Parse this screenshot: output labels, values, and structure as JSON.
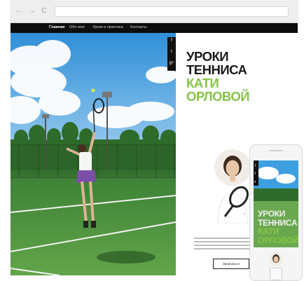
{
  "browser": {
    "nav_icons": [
      "back-icon",
      "forward-icon",
      "reload-icon"
    ],
    "nav_glyphs": "← → C"
  },
  "site": {
    "nav": {
      "items": [
        "Главная",
        "Обо мне",
        "Уроки и практика",
        "Контакты"
      ],
      "active_index": 0
    },
    "social": [
      {
        "icon": "facebook-icon",
        "glyph": "f"
      },
      {
        "icon": "twitter-icon",
        "glyph": "t"
      },
      {
        "icon": "googleplus-icon",
        "glyph": "g+"
      }
    ],
    "title": {
      "line1": "УРОКИ",
      "line2": "ТЕННИСА",
      "line3": "КАТИ",
      "line4": "ОРЛОВОЙ"
    },
    "cta_label": "Записаться"
  },
  "phone": {
    "title": {
      "line1": "УРОКИ",
      "line2": "ТЕННИСА",
      "line3": "КАТИ",
      "line4": "ОРЛОВОЙ"
    }
  },
  "colors": {
    "accent_green": "#86c447",
    "nav_bg": "#0d0d0d",
    "court_green": "#3f8a3c",
    "sky_blue": "#3d9fe0"
  }
}
